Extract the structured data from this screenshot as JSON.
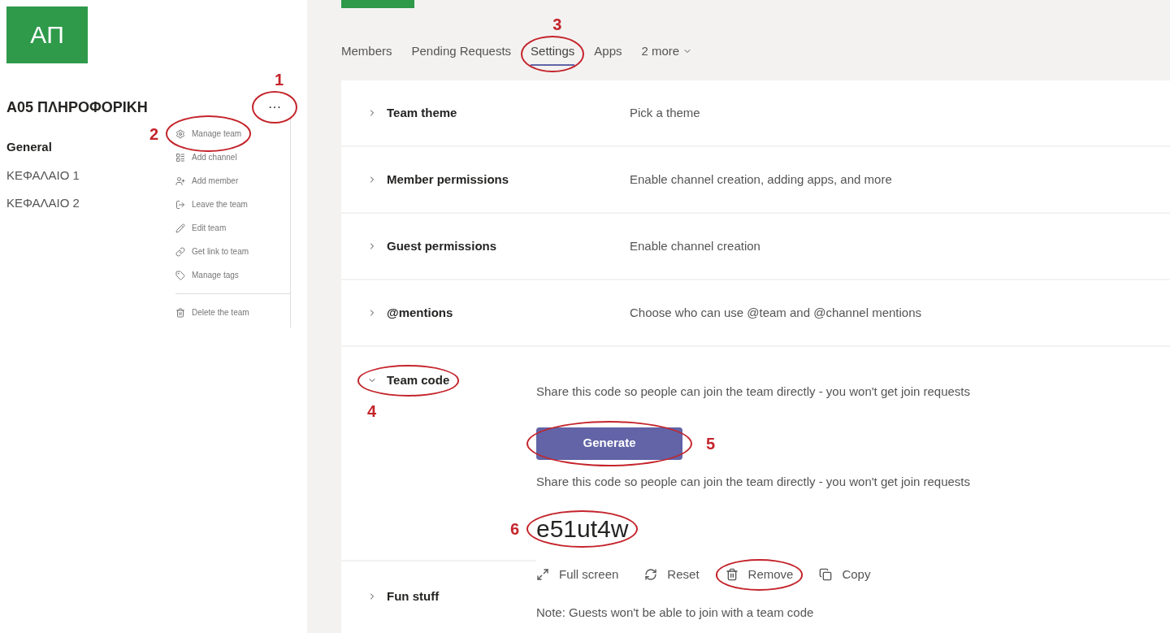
{
  "logo": {
    "initials": "ΑΠ"
  },
  "team": {
    "name": "Α05 ΠΛΗΡΟΦΟΡΙΚΗ",
    "more": {
      "label": "···",
      "circled": true,
      "callout": "1"
    }
  },
  "channels": [
    {
      "name": "General",
      "selected": true
    },
    {
      "name": "ΚΕΦΑΛΑΙΟ 1",
      "selected": false
    },
    {
      "name": "ΚΕΦΑΛΑΙΟ 2",
      "selected": false
    }
  ],
  "menu": [
    {
      "label": "Manage team",
      "circled": true,
      "callout": "2"
    },
    {
      "label": "Add channel"
    },
    {
      "label": "Add member"
    },
    {
      "label": "Leave the team"
    },
    {
      "label": "Edit team"
    },
    {
      "label": "Get link to team"
    },
    {
      "label": "Manage tags"
    },
    {
      "label": "Delete the team"
    }
  ],
  "tabs": [
    {
      "label": "Members",
      "selected": false
    },
    {
      "label": "Pending Requests",
      "selected": false
    },
    {
      "label": "Settings",
      "selected": true,
      "circled": true,
      "callout": "3"
    },
    {
      "label": "Apps",
      "selected": false
    },
    {
      "label": "2 more",
      "selected": false,
      "dropdown": true
    }
  ],
  "settings": [
    {
      "title": "Team theme",
      "description": "Pick a theme",
      "expanded": false
    },
    {
      "title": "Member permissions",
      "description": "Enable channel creation, adding apps, and more",
      "expanded": false
    },
    {
      "title": "Guest permissions",
      "description": "Enable channel creation",
      "expanded": false
    },
    {
      "title": "@mentions",
      "description": "Choose who can use @team and @channel mentions",
      "expanded": false
    }
  ],
  "team_code": {
    "title": "Team code",
    "expanded": true,
    "circled": true,
    "callout": "4",
    "description": "Share this code so people can join the team directly - you won't get join requests",
    "generate": {
      "label": "Generate",
      "circled": true,
      "callout": "5"
    },
    "description_2": "Share this code so people can join the team directly - you won't get join requests",
    "code": {
      "value": "e51ut4w",
      "circled": true,
      "callout": "6"
    },
    "actions": [
      {
        "label": "Full screen"
      },
      {
        "label": "Reset"
      },
      {
        "label": "Remove",
        "circled": true
      },
      {
        "label": "Copy"
      }
    ],
    "note": "Note: Guests won't be able to join with a team code"
  },
  "fun_stuff": {
    "title": "Fun stuff",
    "expanded": false
  }
}
